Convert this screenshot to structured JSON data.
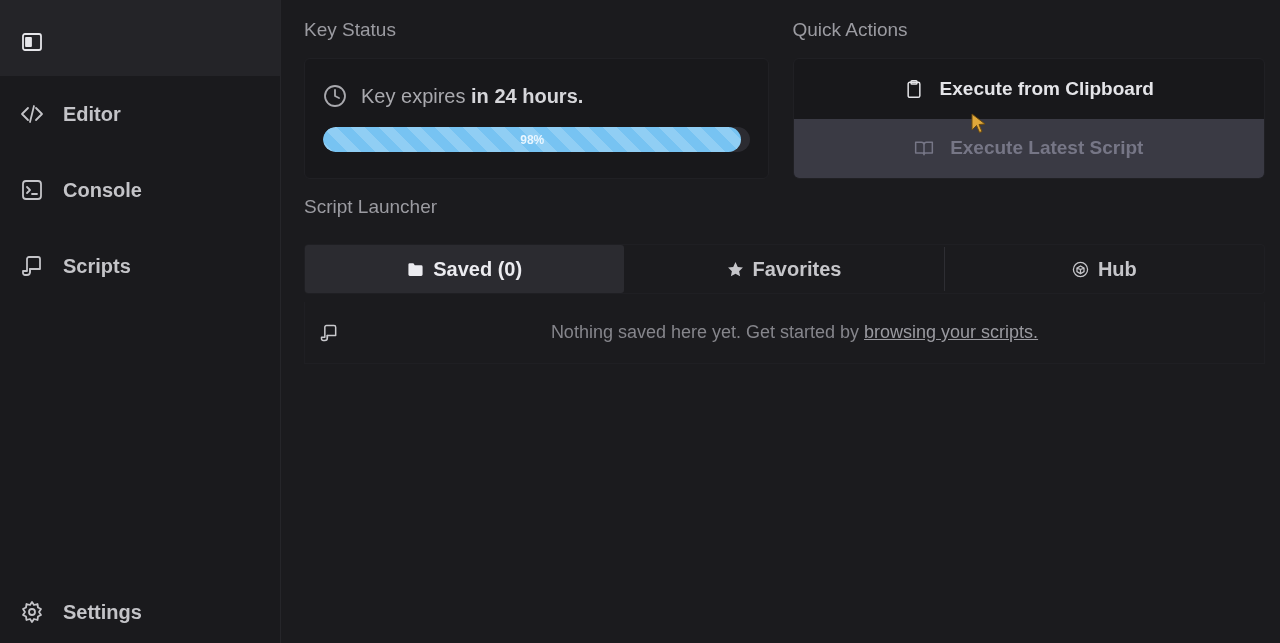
{
  "sidebar": {
    "items": [
      {
        "kind": "home",
        "selected": true
      },
      {
        "kind": "editor",
        "label": "Editor",
        "selected": false
      },
      {
        "kind": "console",
        "label": "Console",
        "selected": false
      },
      {
        "kind": "scripts",
        "label": "Scripts",
        "selected": false
      }
    ],
    "footer_items": [
      {
        "kind": "settings",
        "label": "Settings",
        "selected": false
      }
    ]
  },
  "key_status": {
    "title": "Key Status",
    "message": "Key expires **in 24 hours.**",
    "progress": {
      "level": 0.98,
      "label": "98%"
    }
  },
  "quick_actions": {
    "title": "Quick Actions",
    "buttons": [
      {
        "kind": "clipboard",
        "label": "Execute from Clipboard",
        "disabled": false
      },
      {
        "kind": "script",
        "label": "Execute Latest Script",
        "disabled": true
      }
    ]
  },
  "script_launcher": {
    "title": "Script Launcher",
    "tabs": [
      {
        "kind": "folder",
        "label": "Saved (0)",
        "selected": true
      },
      {
        "kind": "star",
        "label": "Favorites",
        "selected": false
      },
      {
        "kind": "cube",
        "label": "Hub",
        "selected": false
      }
    ],
    "empty_state": {
      "text": "Nothing saved here yet. Get started by",
      "link": "browsing your scripts."
    }
  }
}
